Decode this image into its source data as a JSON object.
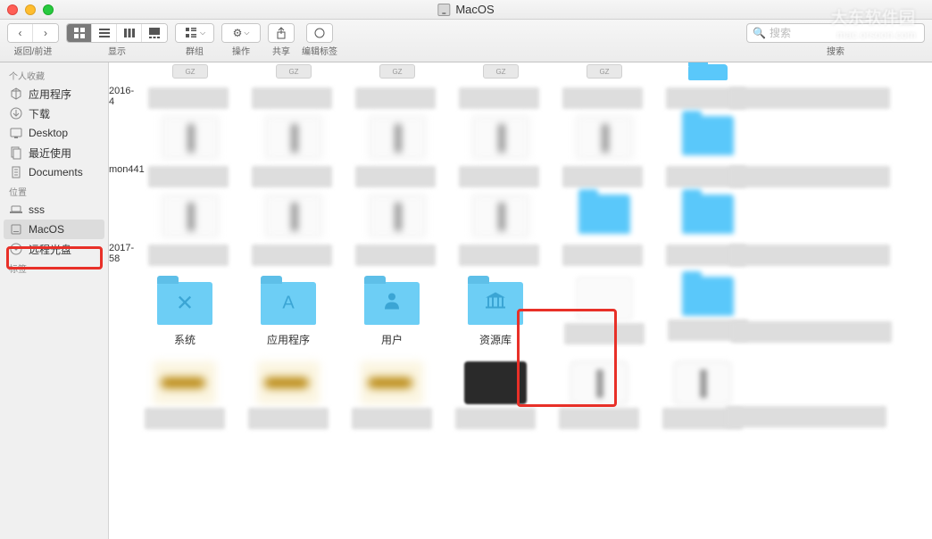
{
  "window": {
    "title": "MacOS"
  },
  "toolbar": {
    "nav_label": "返回/前进",
    "view_label": "显示",
    "group_label": "群组",
    "action_label": "操作",
    "share_label": "共享",
    "tags_label": "编辑标签",
    "search_label": "搜索",
    "search_placeholder": "搜索"
  },
  "sidebar": {
    "favorites": {
      "header": "个人收藏",
      "items": [
        {
          "label": "应用程序",
          "icon": "app"
        },
        {
          "label": "下载",
          "icon": "download"
        },
        {
          "label": "Desktop",
          "icon": "desktop"
        },
        {
          "label": "最近使用",
          "icon": "recent"
        },
        {
          "label": "Documents",
          "icon": "documents"
        }
      ]
    },
    "locations": {
      "header": "位置",
      "items": [
        {
          "label": "sss",
          "icon": "laptop"
        },
        {
          "label": "MacOS",
          "icon": "disk",
          "selected": true
        },
        {
          "label": "远程光盘",
          "icon": "disc"
        }
      ]
    },
    "tags": {
      "header": "标签"
    }
  },
  "folders": [
    {
      "label": "系统",
      "emblem": "X"
    },
    {
      "label": "应用程序",
      "emblem": "A"
    },
    {
      "label": "用户",
      "emblem": "👤"
    },
    {
      "label": "资源库",
      "emblem": "🏛"
    }
  ],
  "dates": [
    "2016-4",
    "mon441",
    "2017-58"
  ],
  "gz_label": "GZ",
  "watermark": {
    "top": "大东软件园",
    "bottom": "mac.orsoon.com"
  }
}
